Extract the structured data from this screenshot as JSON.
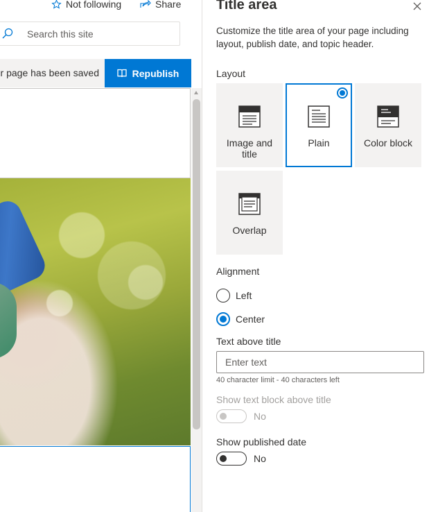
{
  "header": {
    "follow_label": "Not following",
    "share_label": "Share",
    "search_placeholder": "Search this site"
  },
  "savebar": {
    "status_text": "ur page has been saved",
    "republish_label": "Republish"
  },
  "panel": {
    "title": "Title area",
    "description": "Customize the title area of your page including layout, publish date, and topic header.",
    "layout": {
      "label": "Layout",
      "options": [
        {
          "label": "Image and title",
          "selected": false
        },
        {
          "label": "Plain",
          "selected": true
        },
        {
          "label": "Color block",
          "selected": false
        },
        {
          "label": "Overlap",
          "selected": false
        }
      ]
    },
    "alignment": {
      "label": "Alignment",
      "options": [
        {
          "label": "Left",
          "selected": false
        },
        {
          "label": "Center",
          "selected": true
        }
      ]
    },
    "text_above_title": {
      "label": "Text above title",
      "placeholder": "Enter text",
      "value": "",
      "hint": "40 character limit - 40 characters left"
    },
    "show_text_block": {
      "label": "Show text block above title",
      "state_label": "No",
      "enabled": false
    },
    "show_published_date": {
      "label": "Show published date",
      "state_label": "No",
      "on": false
    }
  },
  "colors": {
    "accent": "#0078d4",
    "text": "#323130",
    "muted": "#605e5c",
    "disabled": "#a19f9d",
    "tile_bg": "#f3f2f1"
  }
}
